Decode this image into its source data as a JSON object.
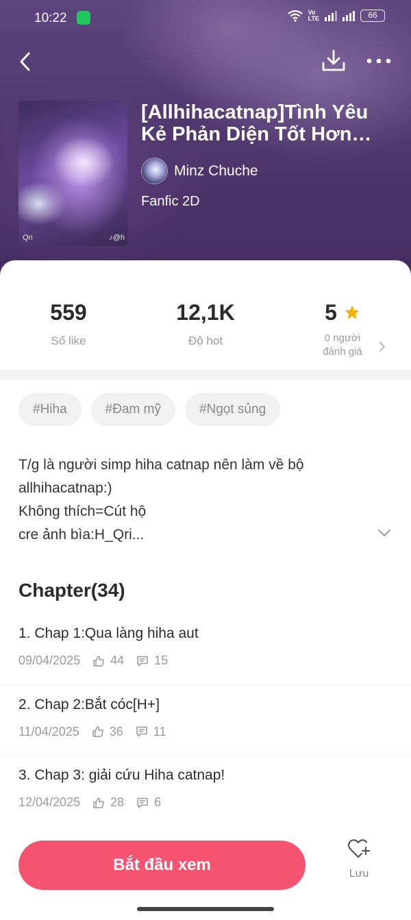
{
  "status_bar": {
    "time": "10:22",
    "volte_top": "Vo",
    "volte_bottom": "LTE",
    "battery": "66"
  },
  "story": {
    "title": "[Allhihacatnap]Tình Yêu Kẻ Phản Diện Tốt Hơn Làng Hiha",
    "author": "Minz Chuche",
    "genre": "Fanfic 2D",
    "cover_tag_left": "Qri",
    "cover_tag_right": "♪@h"
  },
  "stats": {
    "likes_value": "559",
    "likes_label": "Số like",
    "hot_value": "12,1K",
    "hot_label": "Độ hot",
    "rating_value": "5",
    "rating_label_line1": "0 người",
    "rating_label_line2": "đánh giá"
  },
  "tags": [
    "#Hiha",
    "#Đam mỹ",
    "#Ngọt sủng"
  ],
  "description": [
    "T/g là người simp hiha catnap nên làm về bộ",
    "allhihacatnap:)",
    "Không thích=Cút hộ",
    "cre ảnh bìa:H_Qri..."
  ],
  "chapters_header": "Chapter(34)",
  "chapters": [
    {
      "title": "1. Chap 1:Qua làng hiha aut",
      "date": "09/04/2025",
      "likes": "44",
      "comments": "15"
    },
    {
      "title": "2. Chap 2:Bắt cóc[H+]",
      "date": "11/04/2025",
      "likes": "36",
      "comments": "11"
    },
    {
      "title": "3. Chap 3: giải cứu Hiha catnap!",
      "date": "12/04/2025",
      "likes": "28",
      "comments": "6"
    }
  ],
  "bottom": {
    "start_label": "Bắt đầu xem",
    "save_label": "Lưu"
  },
  "colors": {
    "accent": "#f45470",
    "star": "#f5b400",
    "app_icon": "#22c55e"
  }
}
